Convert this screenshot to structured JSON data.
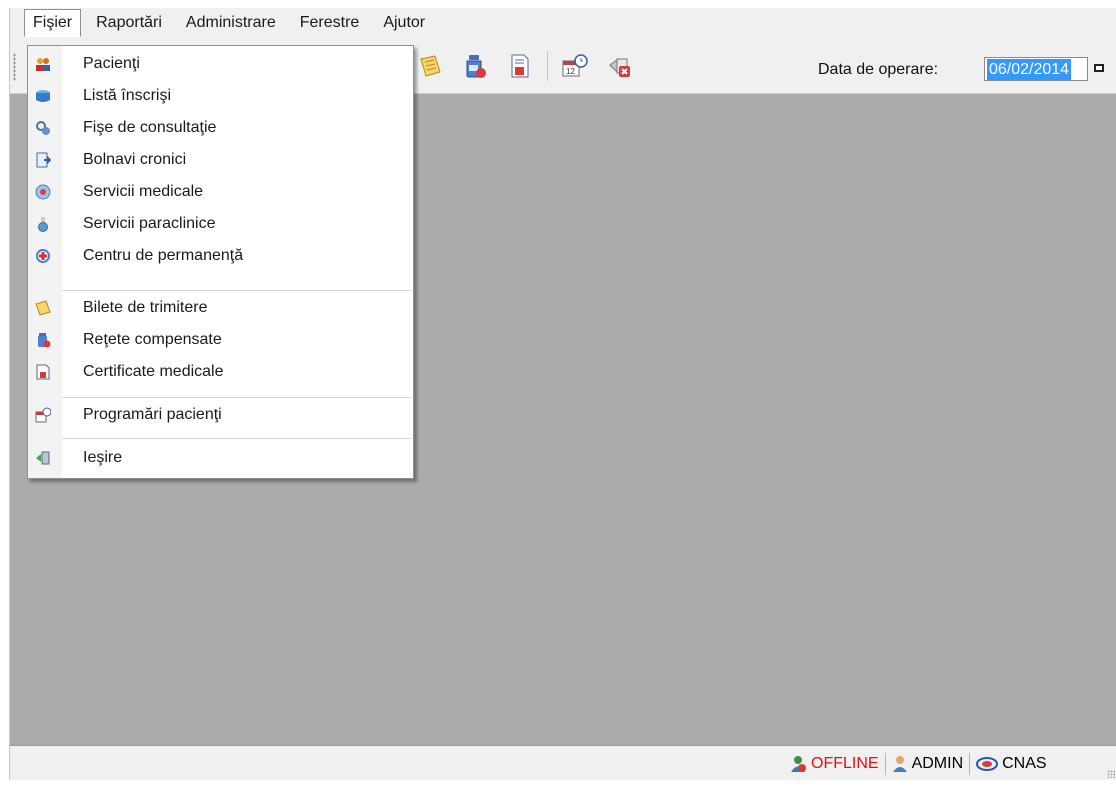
{
  "menubar": {
    "items": [
      {
        "label": "Fişier",
        "active": true
      },
      {
        "label": "Raportări"
      },
      {
        "label": "Administrare"
      },
      {
        "label": "Ferestre"
      },
      {
        "label": "Ajutor"
      }
    ]
  },
  "file_menu": {
    "items": [
      {
        "label": "Pacienţi",
        "icon": "patients-icon"
      },
      {
        "label": "Listă înscrişi",
        "icon": "enrolled-list-icon"
      },
      {
        "label": "Fişe de consultaţie",
        "icon": "consultation-icon"
      },
      {
        "label": "Bolnavi cronici",
        "icon": "chronic-patients-icon"
      },
      {
        "label": "Servicii medicale",
        "icon": "medical-services-icon"
      },
      {
        "label": "Servicii paraclinice",
        "icon": "paraclinical-icon"
      },
      {
        "label": "Centru de permanenţă",
        "icon": "permanence-center-icon"
      },
      {
        "label": "Bilete de trimitere",
        "icon": "referral-icon"
      },
      {
        "label": "Reţete compensate",
        "icon": "prescription-icon"
      },
      {
        "label": "Certificate medicale",
        "icon": "certificate-icon"
      },
      {
        "label": "Programări pacienţi",
        "icon": "appointments-icon"
      },
      {
        "label": "Ieşire",
        "icon": "exit-icon"
      }
    ]
  },
  "toolbar": {
    "icons": [
      "referral-icon",
      "prescription-icon",
      "certificate-icon",
      "appointments-icon",
      "exit-icon"
    ],
    "date_label": "Data de operare:",
    "date_value": "06/02/2014"
  },
  "statusbar": {
    "connection": "OFFLINE",
    "user": "ADMIN",
    "cnas": "CNAS"
  },
  "colors": {
    "workspace": "#ababab",
    "offline": "#e01010",
    "selection": "#3399ff"
  }
}
